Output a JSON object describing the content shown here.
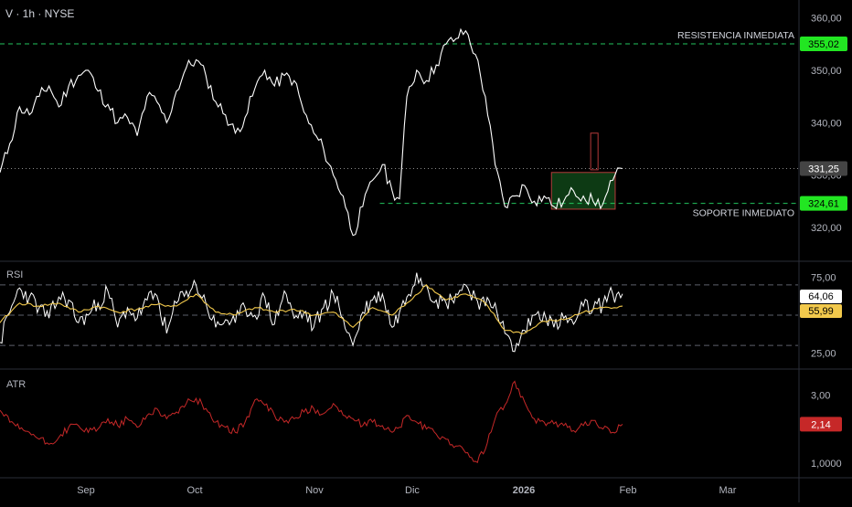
{
  "header": {
    "title": "V · 1h · NYSE"
  },
  "colors": {
    "background": "#000000",
    "price_line": "#ffffff",
    "level_line": "#22c55e",
    "level_badge": "#22e622",
    "current_badge": "#444444",
    "rsi_line": "#ffffff",
    "rsi_ma": "#f2c94c",
    "atr_line": "#c62828",
    "atr_badge": "#c62828",
    "box_fill": "#0d3a14",
    "box_border": "#b33a3a",
    "divider": "#2a2e39"
  },
  "chart_data": [
    {
      "type": "line",
      "panel": "price",
      "title": "V · 1h · NYSE",
      "x_axis_labels": [
        "Sep",
        "Oct",
        "Nov",
        "Dic",
        "2026",
        "Feb",
        "Mar"
      ],
      "ylim": [
        316,
        362
      ],
      "y_ticks": [
        320,
        330,
        340,
        350,
        360
      ],
      "y_tick_labels": [
        "320,00",
        "330,00",
        "340,00",
        "350,00",
        "360,00"
      ],
      "series": [
        {
          "x": [
            0,
            4,
            8,
            12,
            16,
            20,
            24,
            28,
            32,
            36,
            40,
            44,
            48,
            52,
            56,
            60,
            64,
            68,
            72,
            76,
            80,
            84,
            88,
            92,
            96,
            100,
            104,
            108,
            112,
            116,
            120,
            124,
            128,
            132,
            136,
            140,
            144,
            148,
            152,
            156,
            160,
            163,
            166,
            170,
            174,
            178,
            182,
            186,
            190,
            194,
            198,
            202,
            206,
            210,
            214,
            218,
            222,
            226,
            230,
            234,
            238,
            242,
            246,
            250,
            254
          ],
          "y": [
            330.5,
            336,
            343,
            341.5,
            345,
            347,
            343,
            347,
            349,
            350,
            346,
            343.5,
            340,
            341,
            337.5,
            345,
            344,
            340,
            346,
            350.5,
            352,
            349,
            344,
            341.5,
            338,
            341,
            346.5,
            350,
            347,
            349,
            348,
            342,
            338,
            335,
            330,
            326,
            318.5,
            324,
            329,
            332,
            327,
            325.5,
            345,
            350,
            348,
            351,
            355,
            356,
            357.5,
            353,
            345,
            332,
            324,
            326,
            328,
            325,
            326,
            324,
            325,
            327,
            326,
            325,
            324.5,
            329,
            331.25
          ]
        }
      ],
      "levels": [
        {
          "label": "RESISTENCIA INMEDIATA",
          "value": 355.02,
          "value_label": "355,02"
        },
        {
          "label": "SOPORTE INMEDIATO",
          "value": 324.61,
          "value_label": "324,61"
        }
      ],
      "current": {
        "value": 331.25,
        "value_label": "331,25"
      }
    },
    {
      "type": "line",
      "panel": "RSI",
      "title": "RSI",
      "ylim": [
        18,
        82
      ],
      "y_tick_labels": [
        "75,00",
        "25,00"
      ],
      "y_ticks": [
        75,
        25
      ],
      "reference_lines": [
        70,
        50,
        30
      ],
      "series": [
        {
          "name": "RSI",
          "x": [
            0,
            4,
            8,
            12,
            16,
            20,
            24,
            28,
            32,
            36,
            40,
            44,
            48,
            52,
            56,
            60,
            64,
            68,
            72,
            76,
            80,
            84,
            88,
            92,
            96,
            100,
            104,
            108,
            112,
            116,
            120,
            124,
            128,
            132,
            136,
            140,
            144,
            148,
            152,
            156,
            160,
            163,
            166,
            170,
            174,
            178,
            182,
            186,
            190,
            194,
            198,
            202,
            206,
            210,
            214,
            218,
            222,
            226,
            230,
            234,
            238,
            242,
            246,
            250,
            254
          ],
          "y": [
            32,
            52,
            68,
            62,
            55,
            48,
            62,
            60,
            45,
            50,
            58,
            66,
            42,
            55,
            48,
            60,
            63,
            38,
            58,
            66,
            70,
            58,
            42,
            47,
            45,
            55,
            50,
            62,
            44,
            66,
            48,
            52,
            42,
            55,
            64,
            48,
            30,
            52,
            60,
            64,
            42,
            52,
            62,
            78,
            70,
            60,
            58,
            64,
            70,
            62,
            56,
            58,
            38,
            26,
            40,
            50,
            52,
            42,
            48,
            44,
            56,
            54,
            58,
            64,
            64.06
          ]
        },
        {
          "name": "RSI MA",
          "x": [
            0,
            8,
            16,
            24,
            32,
            40,
            48,
            56,
            64,
            72,
            80,
            88,
            96,
            104,
            112,
            120,
            128,
            136,
            144,
            152,
            160,
            166,
            174,
            182,
            190,
            198,
            206,
            214,
            222,
            230,
            238,
            246,
            254
          ],
          "y": [
            45,
            58,
            56,
            58,
            52,
            56,
            52,
            54,
            57,
            56,
            64,
            52,
            50,
            55,
            52,
            54,
            50,
            52,
            42,
            55,
            50,
            58,
            70,
            60,
            64,
            58,
            40,
            38,
            46,
            47,
            52,
            55,
            55.99
          ]
        }
      ],
      "value_labels": {
        "rsi": "64,06",
        "ma": "55,99"
      }
    },
    {
      "type": "line",
      "panel": "ATR",
      "title": "ATR",
      "ylim": [
        0.7,
        3.6
      ],
      "y_ticks": [
        3.0,
        1.0
      ],
      "y_tick_labels": [
        "3,00",
        "1,0000"
      ],
      "series": [
        {
          "name": "ATR",
          "x": [
            0,
            4,
            8,
            12,
            16,
            20,
            24,
            28,
            32,
            36,
            40,
            44,
            48,
            52,
            56,
            60,
            64,
            68,
            72,
            76,
            80,
            84,
            88,
            92,
            96,
            100,
            104,
            108,
            112,
            116,
            120,
            124,
            128,
            132,
            136,
            140,
            144,
            148,
            152,
            156,
            160,
            163,
            166,
            170,
            174,
            178,
            182,
            186,
            190,
            194,
            198,
            202,
            206,
            210,
            214,
            218,
            222,
            226,
            230,
            234,
            238,
            242,
            246,
            250,
            254
          ],
          "y": [
            2.55,
            2.2,
            2.0,
            1.9,
            1.7,
            1.55,
            1.75,
            2.05,
            2.1,
            1.9,
            2.0,
            2.3,
            2.1,
            2.3,
            2.05,
            2.4,
            2.6,
            2.3,
            2.5,
            2.75,
            2.9,
            2.6,
            2.2,
            2.05,
            1.9,
            2.2,
            2.85,
            2.7,
            2.4,
            2.2,
            2.3,
            2.5,
            2.6,
            2.45,
            2.75,
            2.4,
            2.3,
            2.1,
            2.2,
            2.1,
            1.9,
            2.05,
            2.4,
            2.2,
            2.0,
            1.85,
            1.7,
            1.5,
            1.3,
            1.05,
            1.4,
            2.3,
            2.7,
            3.4,
            2.8,
            2.3,
            2.2,
            2.15,
            2.1,
            1.95,
            2.1,
            2.25,
            2.0,
            1.9,
            2.14
          ]
        }
      ],
      "value_labels": {
        "atr": "2,14"
      }
    }
  ]
}
